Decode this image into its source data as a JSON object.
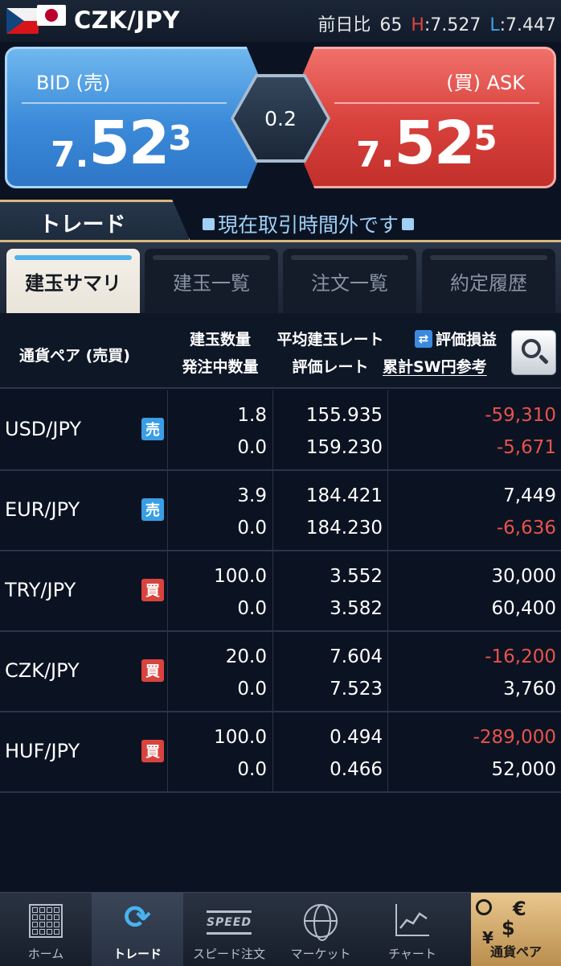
{
  "header": {
    "pair": "CZK/JPY",
    "change_label": "前日比",
    "change_value": "65",
    "high_label": "H",
    "high_value": ":7.527",
    "low_label": "L",
    "low_value": ":7.447"
  },
  "rates": {
    "bid_label": "BID (売)",
    "ask_label": "(買) ASK",
    "bid": {
      "prefix": "7.",
      "big": "52",
      "sup": "3"
    },
    "ask": {
      "prefix": "7.",
      "big": "52",
      "sup": "5"
    },
    "spread": "0.2",
    "colors": {
      "bid": "#3b8ad9",
      "ask": "#d8403b"
    }
  },
  "trade_tab": {
    "label": "トレード",
    "status": "現在取引時間外です"
  },
  "subtabs": [
    {
      "label": "建玉サマリ",
      "active": true
    },
    {
      "label": "建玉一覧",
      "active": false
    },
    {
      "label": "注文一覧",
      "active": false
    },
    {
      "label": "約定履歴",
      "active": false
    }
  ],
  "table": {
    "headers": {
      "pair": "通貨ペア (売買)",
      "qty_top": "建玉数量",
      "qty_bottom": "発注中数量",
      "rate_top": "平均建玉レート",
      "rate_bottom": "評価レート",
      "pl_top": "評価損益",
      "pl_bottom": "累計SW円参考"
    },
    "rows": [
      {
        "pair": "USD/JPY",
        "side": "売",
        "side_type": "sell",
        "qty": "1.8",
        "pending": "0.0",
        "avg_rate": "155.935",
        "eval_rate": "159.230",
        "pl": "-59,310",
        "sw": "-5,671"
      },
      {
        "pair": "EUR/JPY",
        "side": "売",
        "side_type": "sell",
        "qty": "3.9",
        "pending": "0.0",
        "avg_rate": "184.421",
        "eval_rate": "184.230",
        "pl": "7,449",
        "sw": "-6,636"
      },
      {
        "pair": "TRY/JPY",
        "side": "買",
        "side_type": "buy",
        "qty": "100.0",
        "pending": "0.0",
        "avg_rate": "3.552",
        "eval_rate": "3.582",
        "pl": "30,000",
        "sw": "60,400"
      },
      {
        "pair": "CZK/JPY",
        "side": "買",
        "side_type": "buy",
        "qty": "20.0",
        "pending": "0.0",
        "avg_rate": "7.604",
        "eval_rate": "7.523",
        "pl": "-16,200",
        "sw": "3,760"
      },
      {
        "pair": "HUF/JPY",
        "side": "買",
        "side_type": "buy",
        "qty": "100.0",
        "pending": "0.0",
        "avg_rate": "0.494",
        "eval_rate": "0.466",
        "pl": "-289,000",
        "sw": "52,000"
      }
    ]
  },
  "nav": [
    {
      "label": "ホーム",
      "icon": "home-grid-icon"
    },
    {
      "label": "トレード",
      "icon": "trade-cycle-icon",
      "active": true
    },
    {
      "label": "スピード注文",
      "icon": "speed-order-icon",
      "icon_text": "SPEED"
    },
    {
      "label": "マーケット",
      "icon": "globe-icon"
    },
    {
      "label": "チャート",
      "icon": "line-chart-icon"
    },
    {
      "label": "通貨ペア",
      "icon": "currency-pair-icon"
    }
  ]
}
